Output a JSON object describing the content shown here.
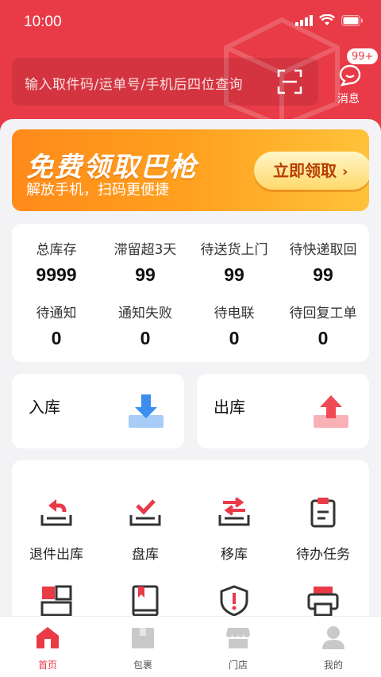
{
  "status": {
    "time": "10:00"
  },
  "search": {
    "placeholder": "输入取件码/运单号/手机后四位查询"
  },
  "message": {
    "badge": "99+",
    "label": "消息"
  },
  "banner": {
    "title": "免费领取巴枪",
    "subtitle": "解放手机，扫码更便捷",
    "cta": "立即领取"
  },
  "stats": [
    {
      "label": "总库存",
      "value": "9999"
    },
    {
      "label": "滞留超3天",
      "value": "99"
    },
    {
      "label": "待送货上门",
      "value": "99"
    },
    {
      "label": "待快递取回",
      "value": "99"
    },
    {
      "label": "待通知",
      "value": "0"
    },
    {
      "label": "通知失败",
      "value": "0"
    },
    {
      "label": "待电联",
      "value": "0"
    },
    {
      "label": "待回复工单",
      "value": "0"
    }
  ],
  "inbound": {
    "label": "入库"
  },
  "outbound": {
    "label": "出库"
  },
  "functions": [
    {
      "label": "退件出库",
      "icon": "return-out-icon"
    },
    {
      "label": "盘库",
      "icon": "inventory-check-icon"
    },
    {
      "label": "移库",
      "icon": "transfer-icon"
    },
    {
      "label": "待办任务",
      "icon": "clipboard-icon"
    },
    {
      "label": "",
      "icon": "boxes-icon"
    },
    {
      "label": "",
      "icon": "book-icon"
    },
    {
      "label": "",
      "icon": "shield-alert-icon"
    },
    {
      "label": "",
      "icon": "printer-icon"
    }
  ],
  "tabs": [
    {
      "label": "首页",
      "icon": "home-icon",
      "active": true
    },
    {
      "label": "包裹",
      "icon": "package-icon",
      "active": false
    },
    {
      "label": "门店",
      "icon": "store-icon",
      "active": false
    },
    {
      "label": "我的",
      "icon": "user-icon",
      "active": false
    }
  ],
  "colors": {
    "brand": "#e83a47",
    "banner_start": "#ff8a1a",
    "banner_end": "#ffc23a",
    "inbound_icon": "#3b8ef0",
    "outbound_icon": "#ef4a55"
  }
}
